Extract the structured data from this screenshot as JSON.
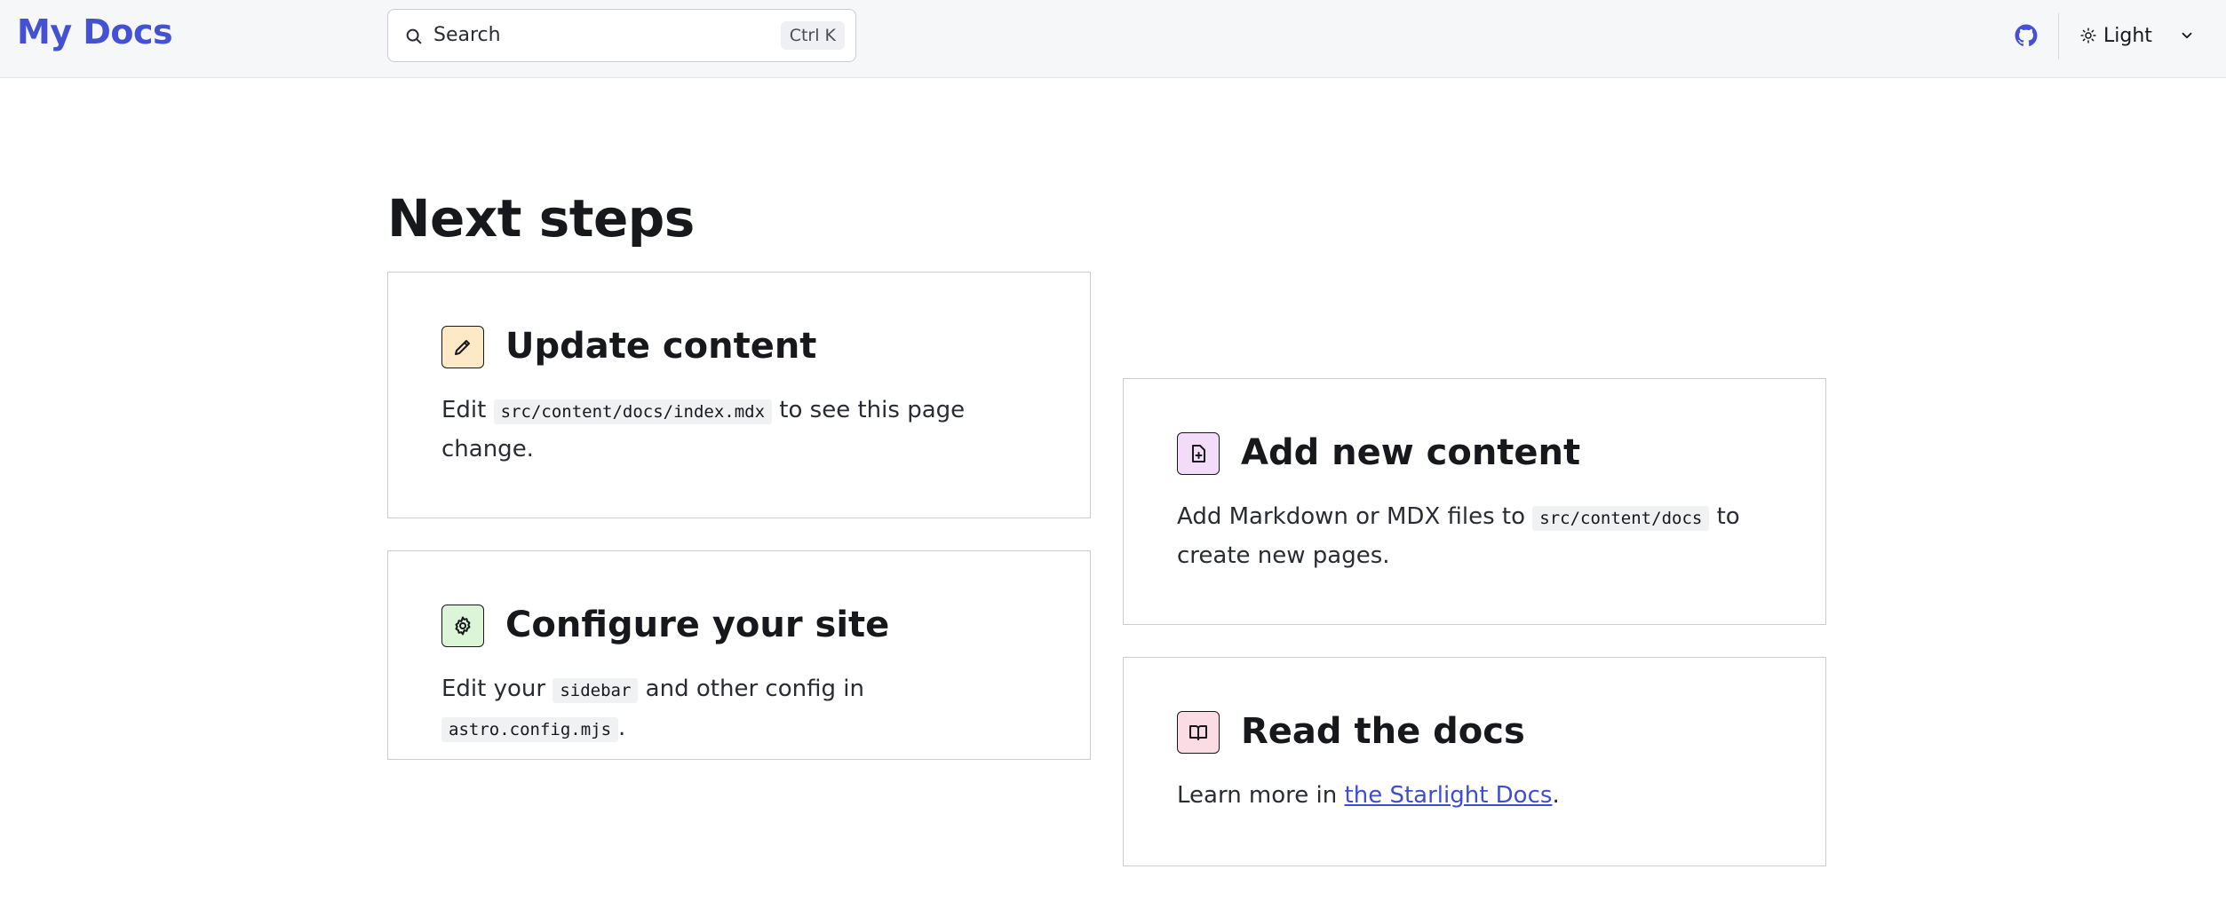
{
  "header": {
    "brand": "My Docs",
    "search": {
      "label": "Search",
      "shortcut": "Ctrl K"
    },
    "theme": {
      "label": "Light"
    }
  },
  "main": {
    "title": "Next steps",
    "cards": [
      {
        "title": "Update content",
        "icon": "pencil-icon",
        "body_pre": "Edit ",
        "code1": "src/content/docs/index.mdx",
        "body_post": " to see this page change."
      },
      {
        "title": "Add new content",
        "icon": "add-document-icon",
        "body_pre": "Add Markdown or MDX files to ",
        "code1": "src/content/docs",
        "body_post": " to create new pages."
      },
      {
        "title": "Configure your site",
        "icon": "gear-icon",
        "body_pre": "Edit your ",
        "code1": "sidebar",
        "body_mid": " and other config in ",
        "code2": "astro.config.mjs",
        "body_post": "."
      },
      {
        "title": "Read the docs",
        "icon": "open-book-icon",
        "body_pre": "Learn more in ",
        "link": "the Starlight Docs",
        "body_post": "."
      }
    ]
  },
  "colors": {
    "brand": "#4451d1",
    "header_bg": "#f6f7f9",
    "link": "#3f4ed1"
  }
}
